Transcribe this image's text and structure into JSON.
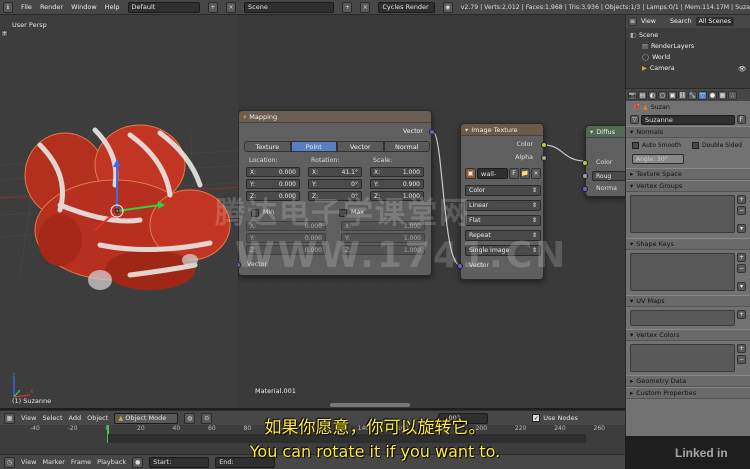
{
  "topbar": {
    "menus": [
      "File",
      "Render",
      "Window",
      "Help"
    ],
    "screen_layout": "Default",
    "scene": "Scene",
    "render_engine": "Cycles Render",
    "stats": "v2.79 | Verts:2,012 | Faces:1,968 | Tris:3,936 | Objects:1/3 | Lamps:0/1 | Mem:114.17M | Suza"
  },
  "viewport": {
    "view_label": "User Persp",
    "object_label": "(1) Suzanne",
    "axes": [
      "x",
      "z"
    ]
  },
  "node_editor": {
    "material_label": "Material.001",
    "mapping": {
      "title": "Mapping",
      "output_vector": "Vector",
      "input_vector": "Vector",
      "tabs": [
        "Texture",
        "Point",
        "Vector",
        "Normal"
      ],
      "active_tab": "Point",
      "col_headers": [
        "Location:",
        "Rotation:",
        "Scale:"
      ],
      "rows": [
        {
          "axis": "X:",
          "loc": "0.000",
          "rot": "41.1°",
          "scale": "1.000"
        },
        {
          "axis": "Y:",
          "loc": "0.000",
          "rot": "0°",
          "scale": "0.900"
        },
        {
          "axis": "Z:",
          "loc": "0.000",
          "rot": "0°",
          "scale": "1.000"
        }
      ],
      "min_label": "Min",
      "max_label": "Max",
      "minmax_rows": [
        {
          "axis": "X:",
          "min": "0.000",
          "max": "1.000"
        },
        {
          "axis": "Y:",
          "min": "0.000",
          "max": "1.000"
        },
        {
          "axis": "Z:",
          "min": "0.000",
          "max": "1.000"
        }
      ]
    },
    "image_texture": {
      "title": "Image Texture",
      "out_color": "Color",
      "out_alpha": "Alpha",
      "image_name": "wall-",
      "image_f": "F",
      "dropdowns": [
        "Color",
        "Linear",
        "Flat",
        "Repeat",
        "Single Image"
      ],
      "in_vector": "Vector"
    },
    "diffuse": {
      "title": "Diffus",
      "in_color": "Color",
      "roughness": "Roug",
      "in_normal": "Norma"
    }
  },
  "right_panel": {
    "header_tabs": [
      "View",
      "Search",
      "All Scenes"
    ],
    "outliner": [
      "Scene",
      "RenderLayers",
      "World",
      "Camera"
    ],
    "object_name": "Suzan",
    "mesh_name": "Suzanne",
    "mesh_f": "F",
    "sections": {
      "normals": "Normals",
      "auto_smooth": "Auto Smooth",
      "double_sided": "Double Sided",
      "angle": "Angle:  30°",
      "texture_space": "Texture Space",
      "vertex_groups": "Vertex Groups",
      "shape_keys": "Shape Keys",
      "uv_maps": "UV Maps",
      "vertex_colors": "Vertex Colors",
      "geometry_data": "Geometry Data",
      "custom_properties": "Custom Properties"
    }
  },
  "viewport_header": {
    "menus": [
      "View",
      "Select",
      "Add",
      "Object"
    ],
    "mode": "Object Mode"
  },
  "node_header": {
    "node_name": "...001",
    "use_nodes": "Use Nodes"
  },
  "timeline": {
    "ticks": [
      "-40",
      "-20",
      "0",
      "20",
      "40",
      "60",
      "80",
      "100",
      "120",
      "140",
      "160",
      "180",
      "200",
      "220",
      "240",
      "260"
    ],
    "menus": [
      "View",
      "Marker",
      "Frame",
      "Playback"
    ],
    "start": "Start:",
    "end": "End:"
  },
  "subtitles": {
    "chinese": "如果你愿意，你可以旋转它。",
    "english": "You can rotate it if you want to."
  },
  "watermarks": {
    "cn": "腾达电子学课堂网",
    "url": "WWW.1741.CN",
    "brand": "Linked in"
  },
  "colors": {
    "active_tab": "#5680c2",
    "subtitle": "#ffeb3b",
    "vector_socket": "#6363c7",
    "color_socket": "#c7c729"
  }
}
